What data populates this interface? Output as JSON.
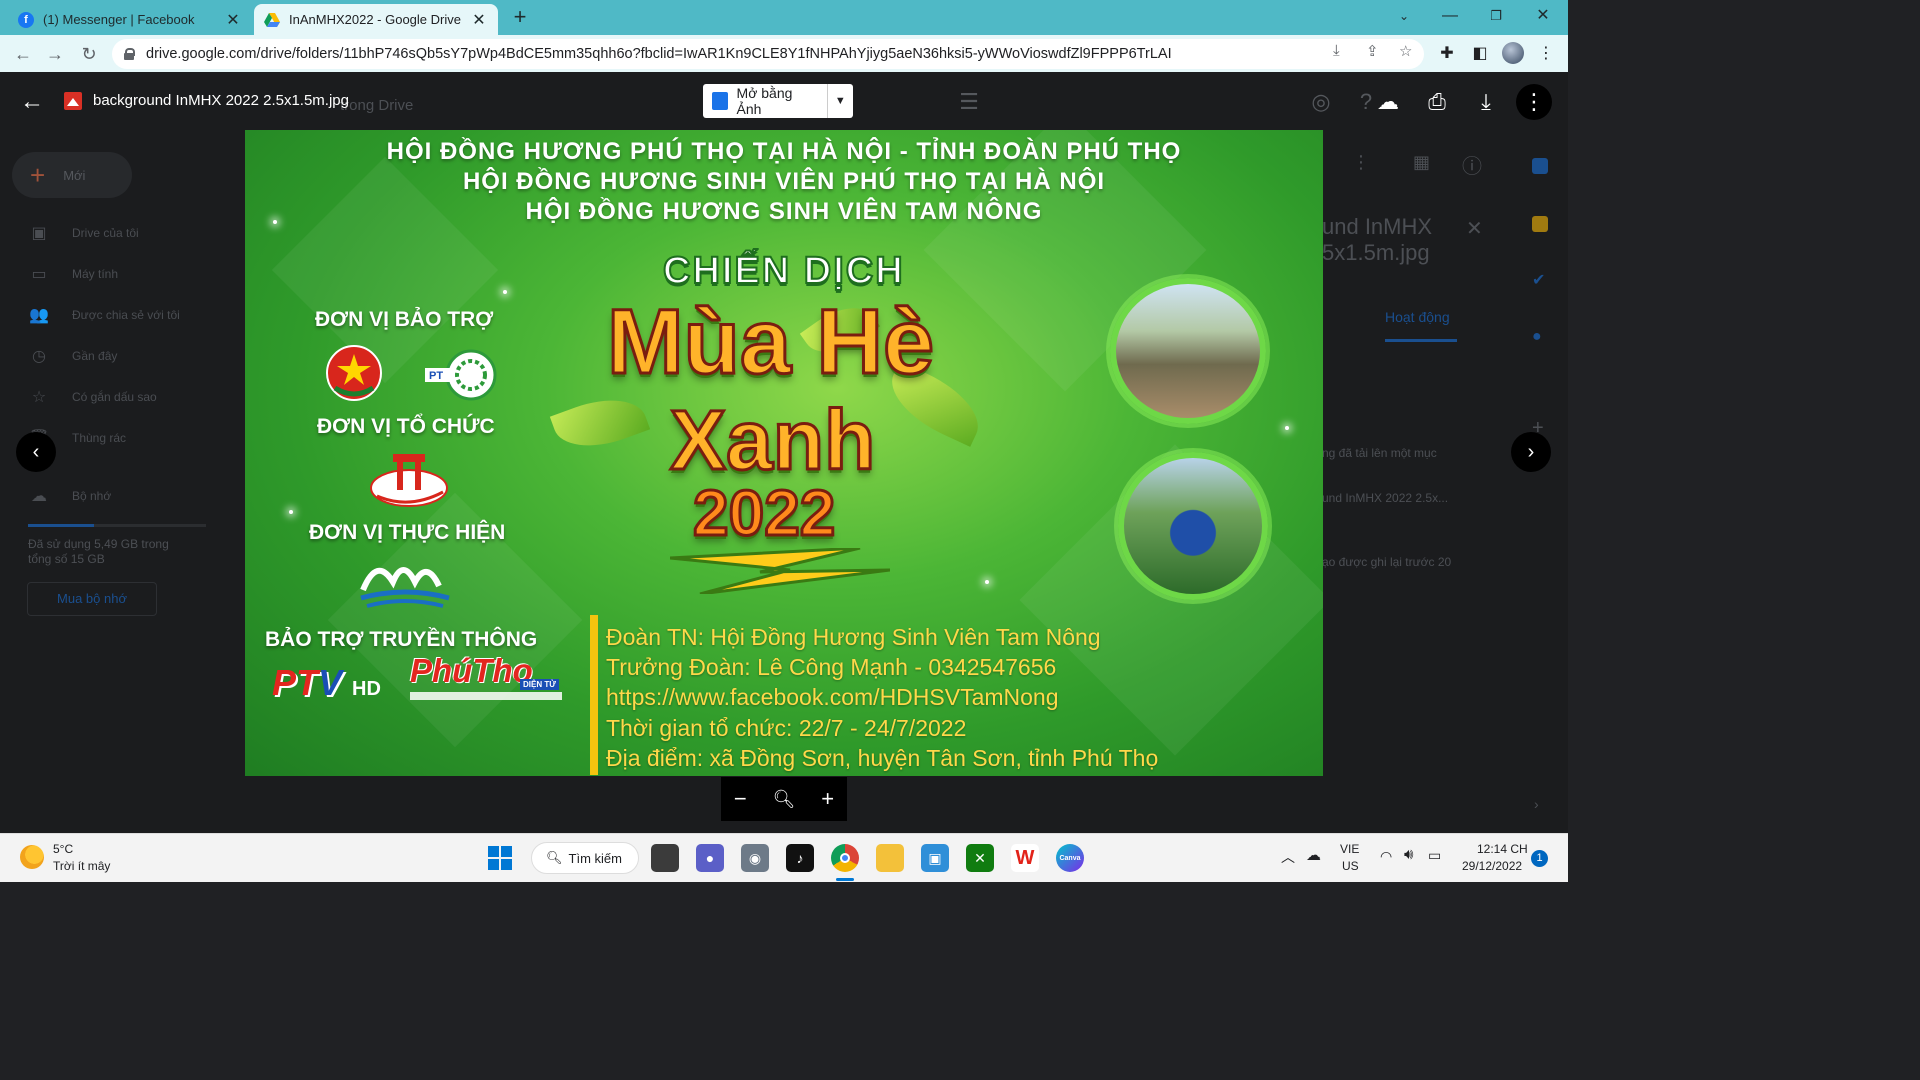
{
  "browser": {
    "tabs": [
      {
        "title": "(1) Messenger | Facebook",
        "icon": "facebook-icon",
        "active": false
      },
      {
        "title": "InAnMHX2022 - Google Drive",
        "icon": "google-drive-icon",
        "active": true
      }
    ],
    "url": "drive.google.com/drive/folders/11bhP746sQb5sY7pWp4BdCE5mm35qhh6o?fbclid=IwAR1Kn9CLE8Y1fNHPAhYjiyg5aeN36hksi5-yWWoVioswdfZl9FPPP6TrLAI"
  },
  "drive": {
    "new_label": "Mới",
    "search_ghost": "trong Drive",
    "sidebar": [
      {
        "label": "Drive của tôi",
        "icon": "my-drive-icon"
      },
      {
        "label": "Máy tính",
        "icon": "computer-icon"
      },
      {
        "label": "Được chia sẻ với tôi",
        "icon": "shared-icon"
      },
      {
        "label": "Gần đây",
        "icon": "clock-icon"
      },
      {
        "label": "Có gắn dấu sao",
        "icon": "star-icon"
      },
      {
        "label": "Thùng rác",
        "icon": "trash-icon"
      }
    ],
    "storage_label": "Bộ nhớ",
    "storage_usage": "Đã sử dụng 5,49 GB trong tổng số 15 GB",
    "storage_fraction": 0.37,
    "buy_storage": "Mua bộ nhớ",
    "panel_title_1": "und InMHX",
    "panel_title_2": "5x1.5m.jpg",
    "panel_tab": "Hoạt động",
    "activity_1": "ng đã tải lên một mục",
    "activity_2": "und InMHX 2022 2.5x...",
    "activity_3": "ạo được ghi lại trước 20"
  },
  "viewer": {
    "file_title": "background InMHX 2022 2.5x1.5m.jpg",
    "open_with": "Mở bằng Ảnh"
  },
  "banner": {
    "header_lines": [
      "HỘI ĐỒNG HƯƠNG PHÚ THỌ TẠI HÀ NỘI - TỈNH ĐOÀN PHÚ THỌ",
      "HỘI ĐỒNG HƯƠNG SINH VIÊN PHÚ THỌ TẠI HÀ NỘI",
      "HỘI ĐỒNG HƯƠNG SINH VIÊN TAM NÔNG"
    ],
    "sponsor_label": "ĐƠN VỊ BẢO TRỢ",
    "organizer_label": "ĐƠN VỊ TỔ CHỨC",
    "implementer_label": "ĐƠN VỊ THỰC HIỆN",
    "media_label": "BẢO TRỢ TRUYỀN THÔNG",
    "campaign_top": "CHIẾN DỊCH",
    "campaign_word1": "Mùa Hè",
    "campaign_word2": "Xanh",
    "campaign_year": "2022",
    "ptv_p": "P",
    "ptv_t": "T",
    "ptv_v": "V",
    "ptv_hd": "HD",
    "phutho_logo": "PhúTho",
    "phutho_tag": "DIỆN TỬ",
    "info_lines": [
      "Đoàn TN: Hội Đồng Hương Sinh Viên Tam Nông",
      "Trưởng Đoàn: Lê Công Mạnh - 0342547656",
      "https://www.facebook.com/HDHSVTamNong",
      "Thời gian tổ chức: 22/7 -  24/7/2022",
      "Địa điểm: xã Đồng Sơn, huyện Tân Sơn, tỉnh Phú Thọ"
    ]
  },
  "taskbar": {
    "weather_temp": "5°C",
    "weather_desc": "Trời ít mây",
    "search_label": "Tìm kiếm",
    "lang_1": "VIE",
    "lang_2": "US",
    "time": "12:14 CH",
    "date": "29/12/2022",
    "notif_count": "1"
  }
}
